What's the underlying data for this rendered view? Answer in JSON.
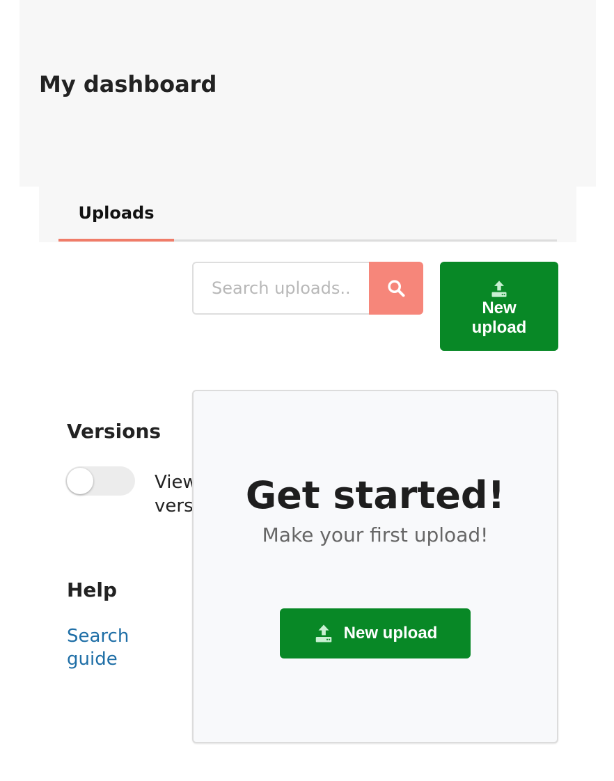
{
  "header": {
    "title": "My dashboard"
  },
  "tabs": [
    {
      "label": "Uploads",
      "active": true
    }
  ],
  "search": {
    "placeholder": "Search uploads..."
  },
  "toolbar": {
    "new_upload_label": "New upload"
  },
  "sidebar": {
    "versions_heading": "Versions",
    "versions_toggle_label": "View all versions",
    "versions_toggle_on": false,
    "help_heading": "Help",
    "help_link_label": "Search guide"
  },
  "empty_state": {
    "title": "Get started!",
    "subtitle": "Make your first upload!",
    "button_label": "New upload"
  },
  "colors": {
    "primary_green": "#088826",
    "accent_salmon": "#f6867a",
    "tab_underline": "#f07c69",
    "link_blue": "#1e6ea6"
  },
  "icons": {
    "search_button": "search-icon",
    "upload_button": "upload-icon"
  }
}
